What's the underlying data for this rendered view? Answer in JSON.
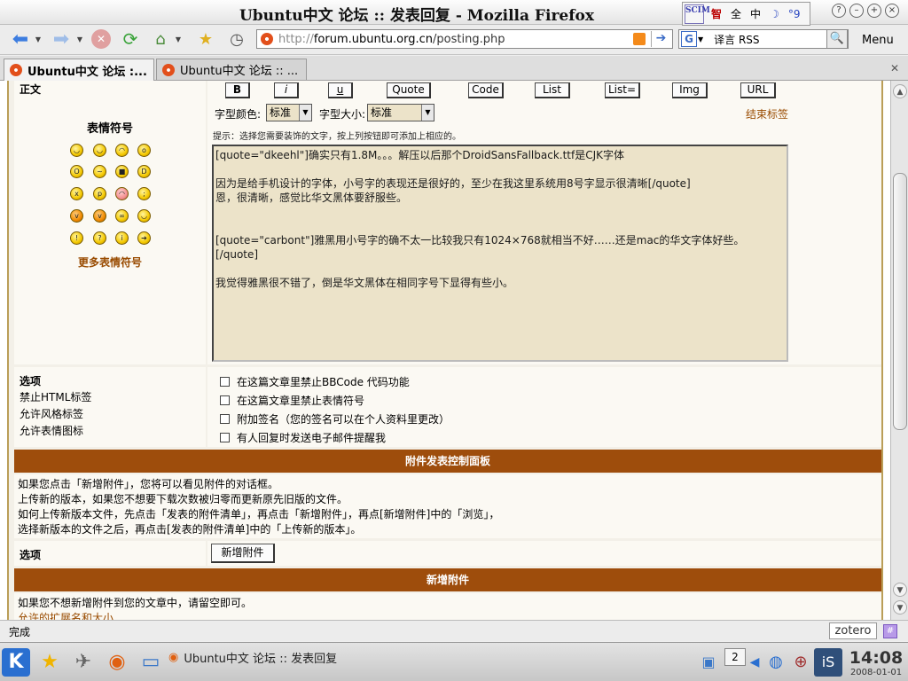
{
  "window": {
    "title": "Ubuntu中文 论坛 :: 发表回复 - Mozilla Firefox"
  },
  "ime": {
    "logo": "SCIM",
    "c1": "智",
    "c2": "全",
    "c3": "中",
    "c4": "☽",
    "c5": "°9"
  },
  "navbar": {
    "url_prefix": "http://",
    "url_domain": "forum.ubuntu.org.cn",
    "url_path": "/posting.php",
    "search_value": "译言 RSS",
    "search_engine": "G",
    "menu_label": "Menu"
  },
  "tabs": [
    {
      "label": "Ubuntu中文 论坛 :...",
      "active": true
    },
    {
      "label": "Ubuntu中文 论坛 :: ...",
      "active": false
    }
  ],
  "editor": {
    "body_label": "正文",
    "smilies_label": "表情符号",
    "more_smilies": "更多表情符号",
    "buttons": [
      "B",
      "i",
      "u",
      "Quote",
      "Code",
      "List",
      "List=",
      "Img",
      "URL"
    ],
    "font_color_label": "字型颜色:",
    "font_color_value": "标准",
    "font_size_label": "字型大小:",
    "font_size_value": "标准",
    "close_tags": "结束标签",
    "hint": "提示：选择您需要装饰的文字，按上列按钮即可添加上相应的。",
    "text_lines": [
      "[quote=\"dkeehl\"]确实只有1.8M。。。解压以后那个DroidSansFallback.ttf是CJK字体",
      "",
      "因为是给手机设计的字体，小号字的表现还是很好的，至少在我这里系统用8号字显示很清晰[/quote]",
      "恩，很清晰，感觉比华文黑体要舒服些。",
      "",
      "",
      "[quote=\"carbont\"]雅黑用小号字的确不太一比较我只有1024×768就相当不好……还是mac的华文字体好些。",
      "[/quote]",
      "",
      "我觉得雅黑很不错了，倒是华文黑体在相同字号下显得有些小。"
    ]
  },
  "options": {
    "label": "选项",
    "left_items": [
      "禁止HTML标签",
      "允许风格标签",
      "允许表情图标"
    ],
    "checkboxes": [
      "在这篇文章里禁止BBCode 代码功能",
      "在这篇文章里禁止表情符号",
      "附加签名（您的签名可以在个人资料里更改）",
      "有人回复时发送电子邮件提醒我"
    ]
  },
  "attach_panel": {
    "title": "附件发表控制面板",
    "lines": [
      "如果您点击「新增附件」，您将可以看见附件的对话框。",
      "上传新的版本，如果您不想要下载次数被归零而更新原先旧版的文件。",
      "如何上传新版本文件，先点击「发表的附件清单」，再点击「新增附件」，再点[新增附件]中的「浏览」，",
      "选择新版本的文件之后，再点击[发表的附件清单]中的「上传新的版本」。"
    ],
    "option_label": "选项",
    "add_button": "新增附件"
  },
  "new_attach": {
    "title": "新增附件",
    "text": "如果您不想新增附件到您的文章中，请留空即可。",
    "partial_link": "允许的扩展名和大小"
  },
  "statusbar": {
    "status": "完成",
    "zotero": "zotero"
  },
  "taskbar": {
    "task_label": "Ubuntu中文 论坛 :: 发表回复",
    "pager": "2",
    "time": "14:08",
    "date": "2008-01-01"
  }
}
